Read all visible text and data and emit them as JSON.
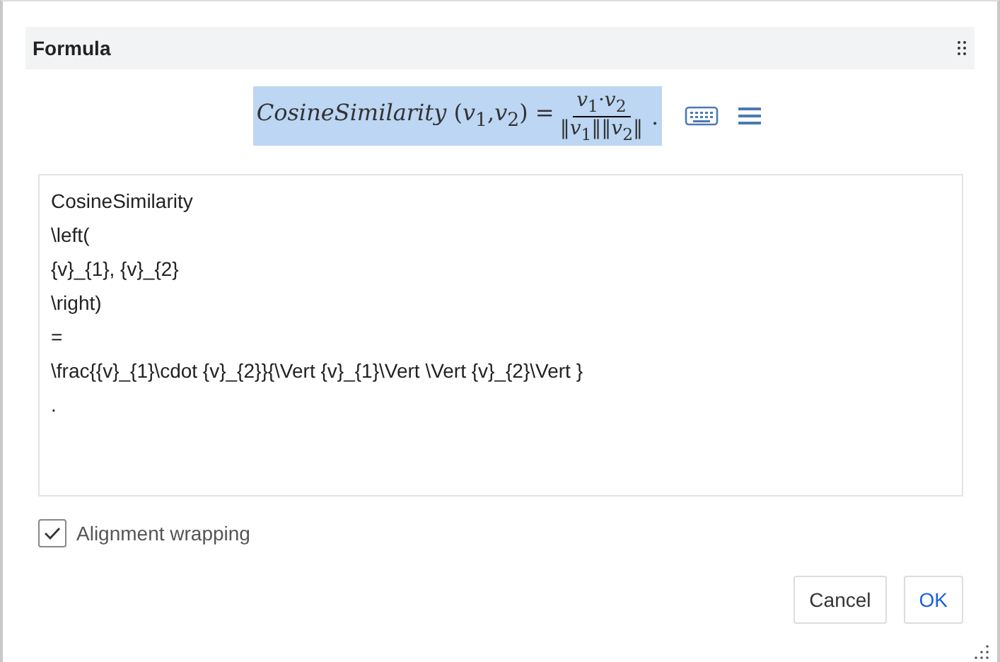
{
  "title": "Formula",
  "formula": {
    "selected": true,
    "lhs": "*CosineSimilarity* (*v*$_{1}$,*v*$_{2}$) =",
    "numerator": "*v*$_{1}$·*v*$_{2}$",
    "denominator": "‖*v*$_{1}$‖‖*v*$_{2}$‖",
    "tail": "."
  },
  "editor_lines": [
    "CosineSimilarity",
    "\\left(",
    "{v}_{1}, {v}_{2}",
    "\\right)",
    "=",
    "\\frac{{v}_{1}\\cdot {v}_{2}}{\\Vert {v}_{1}\\Vert \\Vert {v}_{2}\\Vert }",
    "."
  ],
  "alignment_wrapping": {
    "label": "Alignment wrapping",
    "checked": true
  },
  "buttons": [
    {
      "label": "Cancel",
      "kind": "secondary"
    },
    {
      "label": "OK",
      "kind": "primary"
    }
  ]
}
